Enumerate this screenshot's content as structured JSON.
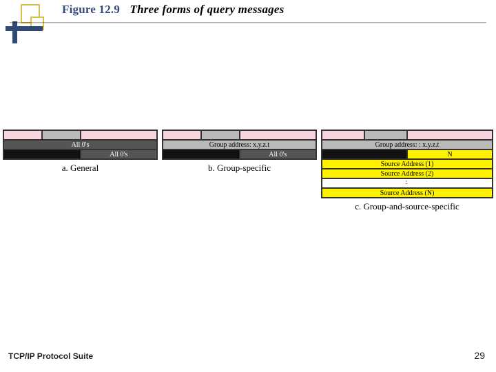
{
  "title": {
    "figure_label": "Figure 12.9",
    "description": "Three forms of query messages"
  },
  "footer": {
    "left": "TCP/IP Protocol Suite",
    "page_number": "29"
  },
  "diagrams": {
    "a": {
      "caption": "a. General",
      "row1": [
        "",
        "",
        "",
        ""
      ],
      "row2": "All 0's",
      "row3_left": "",
      "row3_right": "All 0's"
    },
    "b": {
      "caption": "b. Group-specific",
      "row1": [
        "",
        "",
        "",
        ""
      ],
      "row2": "Group address: x.y.z.t",
      "row3_left": "",
      "row3_right": "All 0's"
    },
    "c": {
      "caption": "c. Group-and-source-specific",
      "row1": [
        "",
        "",
        "",
        ""
      ],
      "row2": "Group address: : x.y.z.t",
      "row3_left": "",
      "row3_right": "N",
      "src1": "Source Address (1)",
      "src2": "Source Address (2)",
      "dots": "⋮",
      "srcN": "Source Address (N)"
    }
  }
}
